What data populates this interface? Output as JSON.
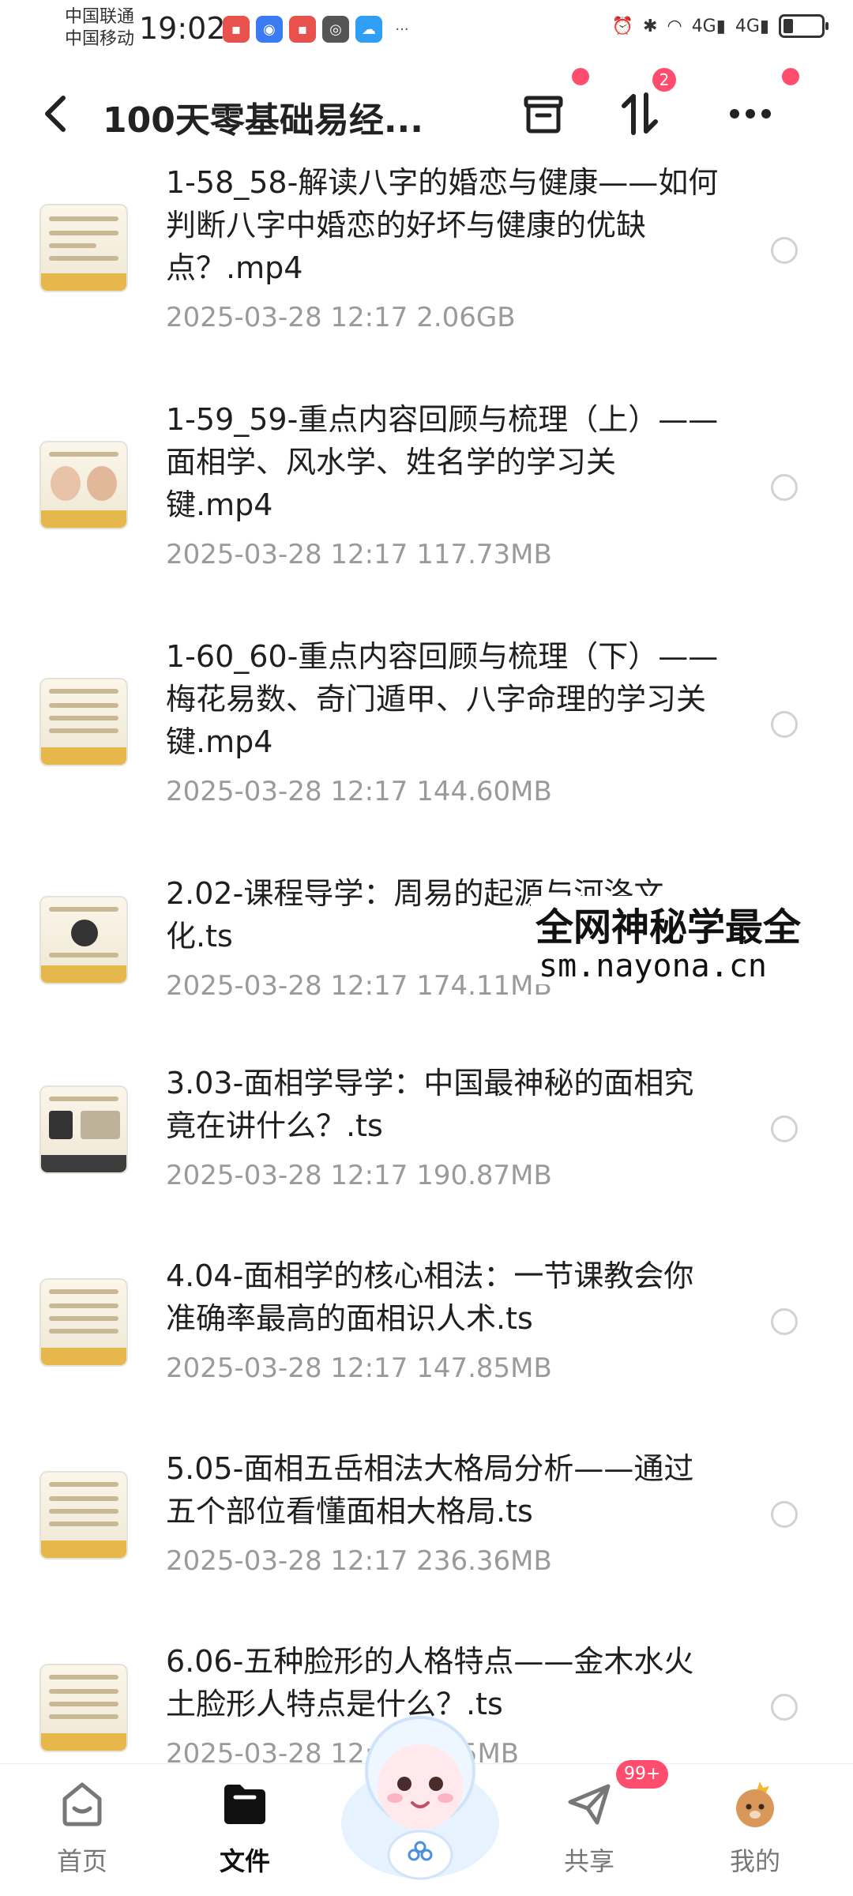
{
  "status_bar": {
    "carrier1": "中国联通",
    "carrier2": "中国移动",
    "time": "19:02",
    "network1": "4G",
    "network2": "4G"
  },
  "header": {
    "title": "100天零基础易经...",
    "sort_badge": "2"
  },
  "files": [
    {
      "name": "1-58_58-解读八字的婚恋与健康——如何判断八字中婚恋的好坏与健康的优缺点？.mp4",
      "date": "2025-03-28",
      "time": "12:17",
      "size": "2.06GB"
    },
    {
      "name": "1-59_59-重点内容回顾与梳理（上）——面相学、风水学、姓名学的学习关键.mp4",
      "date": "2025-03-28",
      "time": "12:17",
      "size": "117.73MB"
    },
    {
      "name": "1-60_60-重点内容回顾与梳理（下）——梅花易数、奇门遁甲、八字命理的学习关键.mp4",
      "date": "2025-03-28",
      "time": "12:17",
      "size": "144.60MB"
    },
    {
      "name": "2.02-课程导学：周易的起源与河洛文化.ts",
      "date": "2025-03-28",
      "time": "12:17",
      "size": "174.11MB"
    },
    {
      "name": "3.03-面相学导学：中国最神秘的面相究竟在讲什么？.ts",
      "date": "2025-03-28",
      "time": "12:17",
      "size": "190.87MB"
    },
    {
      "name": "4.04-面相学的核心相法：一节课教会你准确率最高的面相识人术.ts",
      "date": "2025-03-28",
      "time": "12:17",
      "size": "147.85MB"
    },
    {
      "name": "5.05-面相五岳相法大格局分析——通过五个部位看懂面相大格局.ts",
      "date": "2025-03-28",
      "time": "12:17",
      "size": "236.36MB"
    },
    {
      "name": "6.06-五种脸形的人格特点——金木水火土脸形人特点是什么？.ts",
      "date": "2025-03-28",
      "time": "12:17",
      "size": "…25MB"
    }
  ],
  "watermark": {
    "line1": "全网神秘学最全",
    "line2": "sm.nayona.cn"
  },
  "nav": {
    "home": "首页",
    "files": "文件",
    "share": "共享",
    "share_badge": "99+",
    "mine": "我的"
  },
  "colors": {
    "accent_red": "#ff4d6d",
    "meta_gray": "#9a9a9a"
  }
}
